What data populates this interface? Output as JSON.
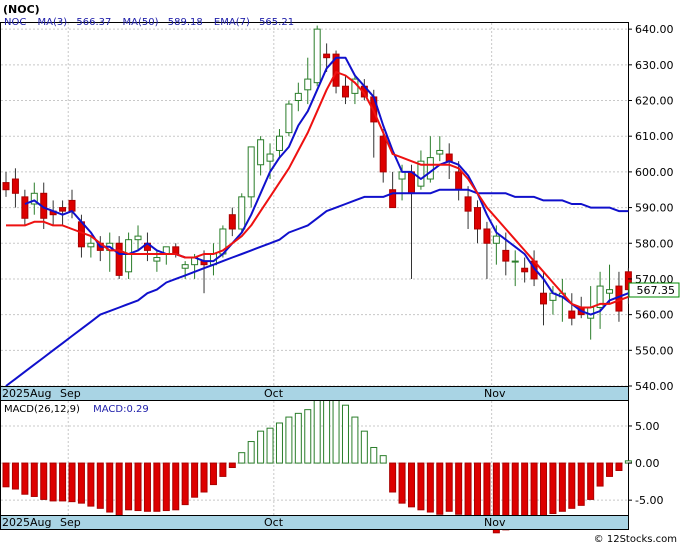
{
  "title": "(NOC)",
  "legend": {
    "symbol": "NOC",
    "ma3": "MA(3)",
    "ma3_value": "566.37",
    "ma50": "MA(50)",
    "ma50_value": "589.18",
    "ema7": "EMA(7)",
    "ema7_value": "565.21",
    "macd_params": "MACD(26,12,9)",
    "macd_value": "MACD:0.29"
  },
  "last_price": "567.35",
  "watermark": "© 12Stocks.com",
  "colors": {
    "up": "#2a7d2a",
    "down": "#dd0000",
    "ma": "#1010cc",
    "ema": "#ee1111",
    "date_bar": "#a9d4e4",
    "grid": "#c8c8c8",
    "label_box": "#008800"
  },
  "chart_data": [
    {
      "type": "candlestick",
      "ylim": [
        540,
        642
      ],
      "y_ticks": [
        "640.00",
        "630.00",
        "620.00",
        "610.00",
        "600.00",
        "590.00",
        "580.00",
        "570.00",
        "560.00",
        "550.00",
        "540.00"
      ],
      "x_labels": [
        "2025Aug",
        "Sep",
        "Oct",
        "Nov"
      ],
      "ohlc": [
        [
          597,
          600,
          593,
          595
        ],
        [
          598,
          601,
          590,
          594
        ],
        [
          593,
          595,
          585,
          587
        ],
        [
          591,
          597,
          588,
          594
        ],
        [
          594,
          597,
          584,
          587
        ],
        [
          589,
          592,
          585,
          588
        ],
        [
          590,
          592,
          585,
          589
        ],
        [
          592,
          595,
          587,
          589
        ],
        [
          586,
          588,
          576,
          579
        ],
        [
          579,
          582,
          576,
          580
        ],
        [
          580,
          582,
          575,
          578
        ],
        [
          578,
          583,
          572,
          580
        ],
        [
          580,
          582,
          570,
          571
        ],
        [
          572,
          583,
          570,
          581
        ],
        [
          581,
          585,
          578,
          582
        ],
        [
          580,
          583,
          575,
          578
        ],
        [
          575,
          578,
          572,
          576
        ],
        [
          577,
          579,
          574,
          579
        ],
        [
          579,
          580,
          576,
          577
        ],
        [
          573,
          575,
          570,
          574
        ],
        [
          574,
          577,
          570,
          576
        ],
        [
          575,
          578,
          566,
          574
        ],
        [
          574,
          580,
          571,
          577
        ],
        [
          577,
          585,
          576,
          584
        ],
        [
          588,
          590,
          582,
          584
        ],
        [
          584,
          594,
          583,
          593
        ],
        [
          593,
          604,
          590,
          607
        ],
        [
          602,
          610,
          599,
          609
        ],
        [
          603,
          608,
          598,
          605
        ],
        [
          606,
          612,
          604,
          610
        ],
        [
          611,
          620,
          610,
          619
        ],
        [
          620,
          625,
          617,
          622
        ],
        [
          623,
          632,
          619,
          626
        ],
        [
          625,
          641,
          624,
          640
        ],
        [
          633,
          636,
          628,
          632
        ],
        [
          633,
          634,
          622,
          624
        ],
        [
          624,
          627,
          619,
          621
        ],
        [
          622,
          627,
          619,
          626
        ],
        [
          624,
          626,
          620,
          621
        ],
        [
          621,
          623,
          604,
          614
        ],
        [
          610,
          612,
          597,
          600
        ],
        [
          595,
          600,
          592,
          590
        ],
        [
          598,
          602,
          592,
          600
        ],
        [
          600,
          602,
          570,
          594
        ],
        [
          596,
          606,
          595,
          603
        ],
        [
          598,
          610,
          597,
          604
        ],
        [
          605,
          610,
          603,
          606
        ],
        [
          605,
          608,
          598,
          603
        ],
        [
          600,
          603,
          592,
          595
        ],
        [
          593,
          596,
          584,
          589
        ],
        [
          590,
          592,
          580,
          584
        ],
        [
          584,
          586,
          570,
          580
        ],
        [
          580,
          585,
          574,
          582
        ],
        [
          578,
          583,
          571,
          575
        ],
        [
          575,
          578,
          568,
          575
        ],
        [
          573,
          576,
          569,
          572
        ],
        [
          575,
          578,
          568,
          570
        ],
        [
          566,
          572,
          557,
          563
        ],
        [
          564,
          568,
          560,
          566
        ],
        [
          565,
          570,
          558,
          566
        ],
        [
          561,
          566,
          557,
          559
        ],
        [
          562,
          565,
          559,
          560
        ],
        [
          559,
          568,
          553,
          562
        ],
        [
          562,
          572,
          556,
          568
        ],
        [
          566,
          574,
          563,
          567
        ],
        [
          568,
          572,
          558,
          561
        ],
        [
          572,
          573,
          563,
          567
        ]
      ],
      "ema7": [
        585,
        585,
        585,
        586,
        586,
        585,
        585,
        584,
        583,
        582,
        580,
        578,
        578,
        577,
        577,
        577,
        577,
        577,
        577,
        576,
        576,
        577,
        577,
        578,
        580,
        582,
        585,
        589,
        593,
        597,
        601,
        606,
        611,
        617,
        623,
        628,
        627,
        625,
        622,
        617,
        611,
        605,
        604,
        603,
        602,
        602,
        602,
        602,
        601,
        598,
        594,
        590,
        587,
        584,
        581,
        578,
        575,
        572,
        569,
        566,
        563,
        562,
        562,
        563,
        563,
        564,
        565
      ],
      "ma3": [
        null,
        null,
        591,
        592,
        590,
        589,
        588,
        589,
        586,
        583,
        579,
        579,
        577,
        577,
        578,
        580,
        578,
        577,
        577,
        576,
        576,
        575,
        575,
        577,
        580,
        583,
        588,
        594,
        600,
        604,
        607,
        613,
        617,
        623,
        629,
        632,
        632,
        627,
        624,
        621,
        613,
        606,
        600,
        600,
        598,
        600,
        602,
        603,
        602,
        599,
        594,
        588,
        583,
        581,
        579,
        577,
        573,
        570,
        566,
        565,
        563,
        561,
        560,
        561,
        564,
        565,
        566
      ],
      "ma50": [
        540,
        542,
        544,
        546,
        548,
        550,
        552,
        554,
        556,
        558,
        560,
        561,
        562,
        563,
        564,
        566,
        567,
        569,
        570,
        571,
        572,
        573,
        574,
        575,
        576,
        577,
        578,
        579,
        580,
        581,
        583,
        584,
        585,
        587,
        589,
        590,
        591,
        592,
        593,
        593,
        593,
        594,
        594,
        594,
        594,
        594,
        595,
        595,
        595,
        595,
        594,
        594,
        594,
        594,
        593,
        593,
        593,
        592,
        592,
        592,
        591,
        591,
        590,
        590,
        590,
        589,
        589
      ]
    },
    {
      "type": "bar",
      "title": "MACD(26,12,9)",
      "ylim": [
        -7,
        8.5
      ],
      "y_ticks": [
        "5.00",
        "0.00",
        "-5.00"
      ],
      "x_labels": [
        "2025Aug",
        "Sep",
        "Oct",
        "Nov"
      ],
      "values": [
        -3.2,
        -3.5,
        -4.2,
        -4.5,
        -4.9,
        -5.1,
        -5.1,
        -5.2,
        -5.4,
        -5.8,
        -6.1,
        -6.6,
        -7.1,
        -6.3,
        -6.4,
        -6.5,
        -6.5,
        -6.4,
        -6.3,
        -5.6,
        -4.6,
        -3.9,
        -2.9,
        -1.8,
        -0.6,
        1.4,
        2.9,
        4.3,
        4.7,
        5.4,
        6.2,
        6.7,
        7.2,
        8.8,
        9.2,
        8.5,
        7.8,
        6.2,
        4.3,
        2.1,
        1.0,
        -3.9,
        -5.4,
        -5.9,
        -6.3,
        -6.6,
        -6.9,
        -6.5,
        -6.9,
        -7.9,
        -8.2,
        -8.8,
        -9.4,
        -9.0,
        -8.8,
        -8.4,
        -8.0,
        -7.6,
        -6.8,
        -6.5,
        -6.1,
        -5.7,
        -4.9,
        -3.1,
        -1.8,
        -1.0,
        0.3
      ]
    }
  ]
}
